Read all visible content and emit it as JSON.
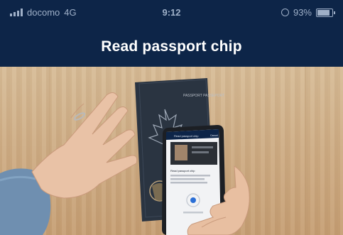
{
  "status_bar": {
    "carrier": "docomo",
    "network": "4G",
    "time": "9:12",
    "battery": "93%",
    "battery_level": 0.93
  },
  "header": {
    "title": "Read passport chip"
  },
  "photo": {
    "passport_cover_text": "PASSPORT PASSEPORT",
    "phone_screen": {
      "header_title": "Read passport chip",
      "close_label": "Cancel",
      "instruction_title": "Read passport chip"
    }
  },
  "colors": {
    "header_bg": "#0d2548",
    "header_text": "#ffffff",
    "passport": "#2a3441",
    "table": "#d2b38b"
  }
}
